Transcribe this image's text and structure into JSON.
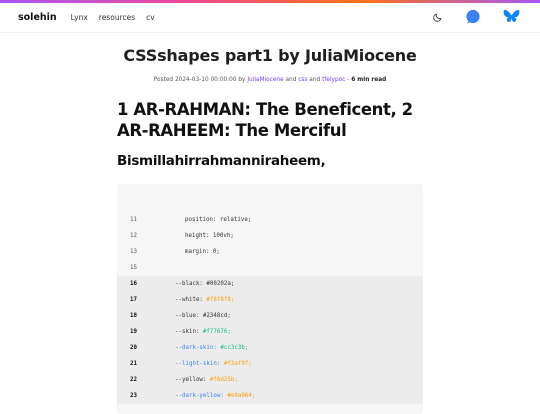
{
  "nav": {
    "brand": "solehin",
    "links": [
      "Lynx",
      "resources",
      "cv"
    ]
  },
  "icons": {
    "theme": "moon-icon",
    "chat": "chat-bubble-icon",
    "social": "butterfly-icon"
  },
  "colors": {
    "accent": "#7c3aed",
    "chat_icon": "#3b82f6",
    "social_icon": "#1185fe"
  },
  "post": {
    "title": "CSSshapes part1 by JuliaMiocene",
    "meta_prefix": "Posted 2024-03-10 00:00:00 by ",
    "tag1": "JuliaMiocene",
    "and1": " and ",
    "tag2": "css",
    "and2": " and ",
    "tag3": "tfelypoc",
    "sep": " - ",
    "read_time": "6 min read",
    "heading": "1 AR-RAHMAN: The Beneficent, 2 AR-RAHEEM: The Merciful",
    "subheading": "Bismillahirrahmanniraheem,"
  },
  "code": {
    "lines": [
      {
        "n": "11",
        "text": "position: relative;"
      },
      {
        "n": "12",
        "text": "height: 100vh;"
      },
      {
        "n": "13",
        "text": "margin: 0;"
      },
      {
        "n": "15",
        "text": ""
      },
      {
        "n": "16",
        "key": "--black: ",
        "val": "#00202a;"
      },
      {
        "n": "17",
        "key": "--white: ",
        "val": "#f8f8f8;"
      },
      {
        "n": "18",
        "key": "--blue: ",
        "val": "#2348cd;"
      },
      {
        "n": "19",
        "key": "--skin: ",
        "val": "#f77676;"
      },
      {
        "n": "20",
        "key": "--dark-skin: ",
        "val": "#cc3c3b;"
      },
      {
        "n": "21",
        "key": "--light-skin: ",
        "val": "#f3af9f;"
      },
      {
        "n": "22",
        "key": "--yellow: ",
        "val": "#f6d25b;"
      },
      {
        "n": "23",
        "key": "--dark-yellow: ",
        "val": "#e9a964;"
      }
    ]
  }
}
